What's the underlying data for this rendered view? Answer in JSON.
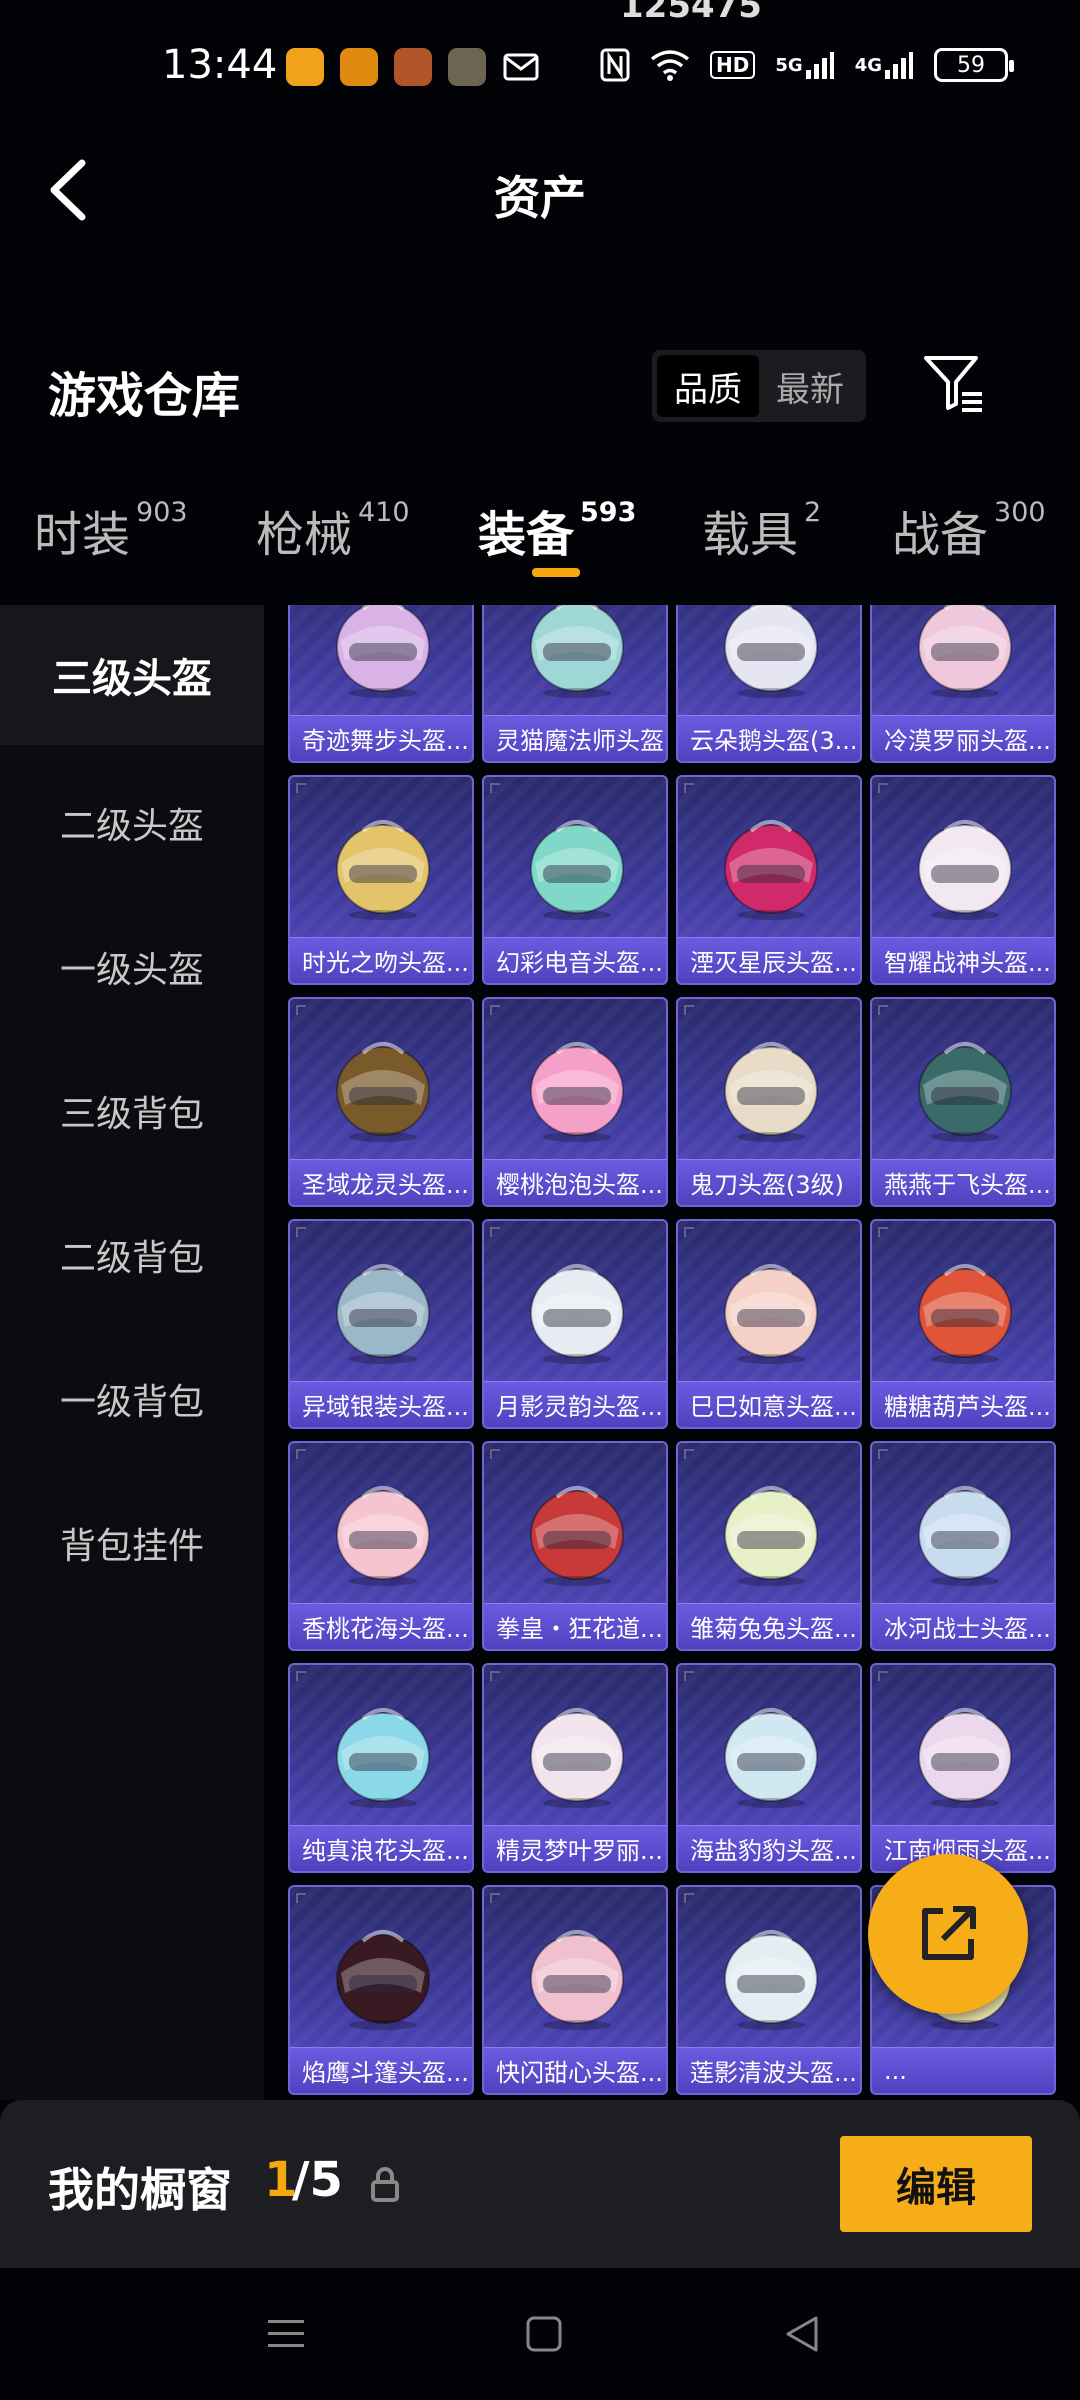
{
  "status_bar": {
    "top_number": "125475",
    "time": "13:44",
    "apps": [
      {
        "icon": "app-icon-1",
        "color": "#f0a21a"
      },
      {
        "icon": "app-icon-2",
        "color": "#e08a10"
      },
      {
        "icon": "app-icon-3",
        "color": "#b0552a"
      },
      {
        "icon": "app-icon-4",
        "color": "#6d6552"
      },
      {
        "icon": "mail-icon",
        "color": "transparent"
      }
    ],
    "hd": "HD",
    "net1": "5G",
    "net2": "4G",
    "battery": "59"
  },
  "header": {
    "title": "资产"
  },
  "section": {
    "title": "游戏仓库",
    "sort_options": [
      "品质",
      "最新"
    ],
    "active_sort": "品质"
  },
  "tabs": [
    {
      "label": "时装",
      "count": "903"
    },
    {
      "label": "枪械",
      "count": "410"
    },
    {
      "label": "装备",
      "count": "593",
      "active": true
    },
    {
      "label": "载具",
      "count": "2"
    },
    {
      "label": "战备",
      "count": "300"
    }
  ],
  "sidebar": [
    {
      "label": "三级头盔",
      "active": true
    },
    {
      "label": "二级头盔"
    },
    {
      "label": "一级头盔"
    },
    {
      "label": "三级背包"
    },
    {
      "label": "二级背包"
    },
    {
      "label": "一级背包"
    },
    {
      "label": "背包挂件"
    }
  ],
  "grid": {
    "items": [
      {
        "name": "奇迹舞步头盔...",
        "color": "#d9b3e6"
      },
      {
        "name": "灵猫魔法师头盔...",
        "color": "#9fd6d6"
      },
      {
        "name": "云朵鹅头盔(3...",
        "color": "#e6e6f2"
      },
      {
        "name": "冷漠罗丽头盔...",
        "color": "#f0c8dc"
      },
      {
        "name": "时光之吻头盔...",
        "color": "#e4c46a"
      },
      {
        "name": "幻彩电音头盔...",
        "color": "#7fd8c8"
      },
      {
        "name": "湮灭星辰头盔...",
        "color": "#d02a6a"
      },
      {
        "name": "智耀战神头盔...",
        "color": "#f2e8f2"
      },
      {
        "name": "圣域龙灵头盔...",
        "color": "#7a5a2a"
      },
      {
        "name": "樱桃泡泡头盔...",
        "color": "#f5a0c8"
      },
      {
        "name": "鬼刀头盔(3级)",
        "color": "#e8dcc8"
      },
      {
        "name": "燕燕于飞头盔...",
        "color": "#3a6a6a"
      },
      {
        "name": "异域银装头盔...",
        "color": "#9ab8c8"
      },
      {
        "name": "月影灵韵头盔...",
        "color": "#e8ecf2"
      },
      {
        "name": "巳巳如意头盔...",
        "color": "#f5d0c8"
      },
      {
        "name": "糖糖葫芦头盔...",
        "color": "#e0543a"
      },
      {
        "name": "香桃花海头盔...",
        "color": "#f5c4d0"
      },
      {
        "name": "拳皇・狂花道...",
        "color": "#c83a3a"
      },
      {
        "name": "雏菊兔兔头盔...",
        "color": "#e8f0c8"
      },
      {
        "name": "冰河战士头盔...",
        "color": "#c8dcf0"
      },
      {
        "name": "纯真浪花头盔...",
        "color": "#8ad8e8"
      },
      {
        "name": "精灵梦叶罗丽...",
        "color": "#f2e4ec"
      },
      {
        "name": "海盐豹豹头盔...",
        "color": "#d0e8f2"
      },
      {
        "name": "江南烟雨头盔...",
        "color": "#ecd8ec"
      },
      {
        "name": "焰鹰斗篷头盔...",
        "color": "#3a1a22"
      },
      {
        "name": "快闪甜心头盔...",
        "color": "#f0c0d0"
      },
      {
        "name": "莲影清波头盔...",
        "color": "#e4eef2"
      },
      {
        "name": "...",
        "color": "#f0e8b0"
      },
      {
        "name": "",
        "color": "#4a4a4a"
      },
      {
        "name": "",
        "color": "#d83a3a"
      },
      {
        "name": "",
        "color": "#e8d090"
      },
      {
        "name": "",
        "color": "#c8e0f0"
      }
    ]
  },
  "showcase": {
    "label": "我的橱窗",
    "current": "1",
    "total": "/5",
    "edit_label": "编辑"
  },
  "colors": {
    "accent": "#f7ad18",
    "card_bg": "#3e3a9c",
    "card_label": "#5b4ac9"
  }
}
